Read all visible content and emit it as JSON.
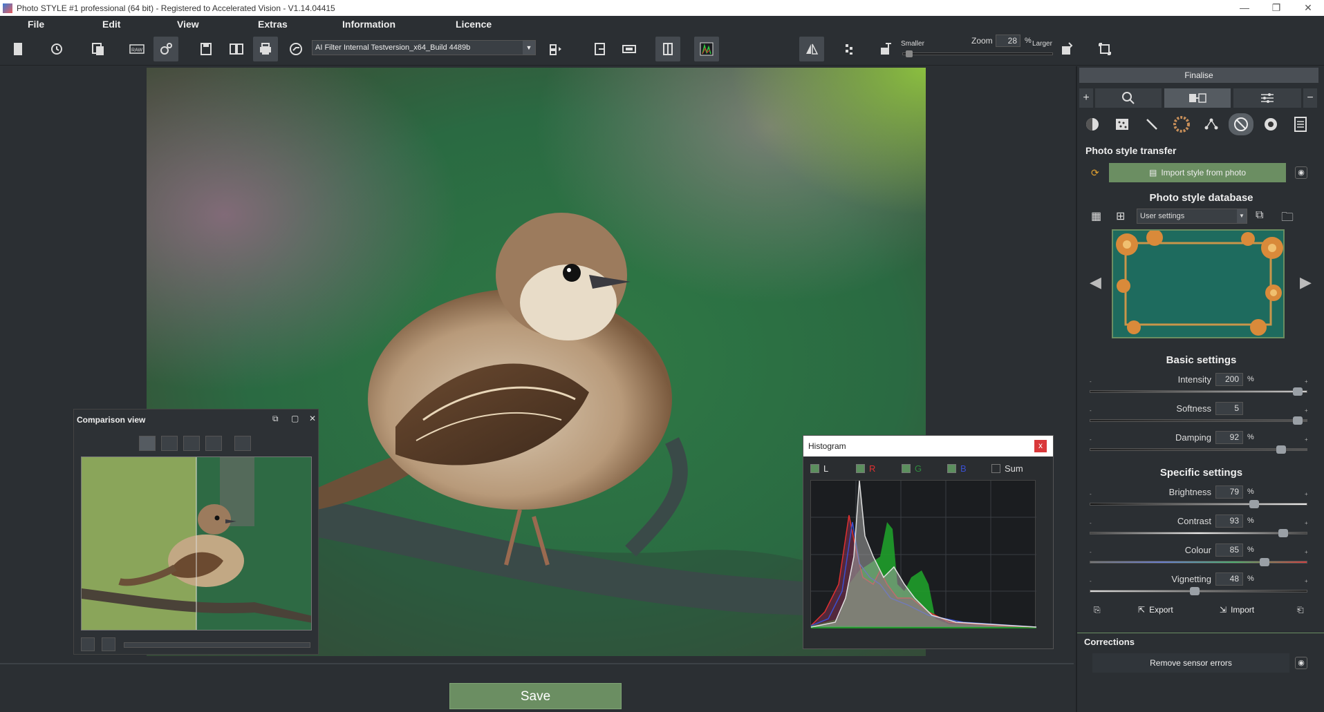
{
  "window": {
    "title": "Photo STYLE #1 professional (64 bit) - Registered to Accelerated Vision - V1.14.04415"
  },
  "menu": [
    "File",
    "Edit",
    "View",
    "Extras",
    "Information",
    "Licence"
  ],
  "toolbar": {
    "filter_value": "AI Filter Internal Testversion_x64_Build 4489b",
    "zoom_label": "Zoom",
    "zoom_value": "28",
    "zoom_unit": "%",
    "smaller_label": "Smaller",
    "larger_label": "Larger",
    "zoom_slider_fraction": 0.02
  },
  "comparison": {
    "title": "Comparison view"
  },
  "histogram": {
    "title": "Histogram",
    "close": "x",
    "channels": [
      {
        "label": "L",
        "checked": true,
        "color": "#e0e0e0"
      },
      {
        "label": "R",
        "checked": true,
        "color": "#e03030"
      },
      {
        "label": "G",
        "checked": true,
        "color": "#2e8b3e"
      },
      {
        "label": "B",
        "checked": true,
        "color": "#3a4fd0"
      },
      {
        "label": "Sum",
        "checked": false,
        "color": "#e0e0e0"
      }
    ]
  },
  "right_panel": {
    "finalise": "Finalise",
    "photo_style_transfer": "Photo style transfer",
    "import_style": "Import style from photo",
    "database_title": "Photo style database",
    "database_value": "User settings",
    "basic_title": "Basic settings",
    "specific_title": "Specific settings",
    "basic": [
      {
        "label": "Intensity",
        "value": "200",
        "unit": "%",
        "fraction": 0.98
      },
      {
        "label": "Softness",
        "value": "5",
        "unit": "",
        "fraction": 0.98
      },
      {
        "label": "Damping",
        "value": "92",
        "unit": "%",
        "fraction": 0.9
      }
    ],
    "specific": [
      {
        "label": "Brightness",
        "value": "79",
        "unit": "%",
        "fraction": 0.77
      },
      {
        "label": "Contrast",
        "value": "93",
        "unit": "%",
        "fraction": 0.91
      },
      {
        "label": "Colour",
        "value": "85",
        "unit": "%",
        "fraction": 0.82
      },
      {
        "label": "Vignetting",
        "value": "48",
        "unit": "%",
        "fraction": 0.48
      }
    ],
    "export_label": "Export",
    "import_label": "Import",
    "corrections_title": "Corrections",
    "remove_sensor": "Remove sensor errors"
  },
  "bottom": {
    "save": "Save"
  },
  "colors": {
    "accent_green": "#6b8e62",
    "panel_bg": "#2b2f33"
  }
}
